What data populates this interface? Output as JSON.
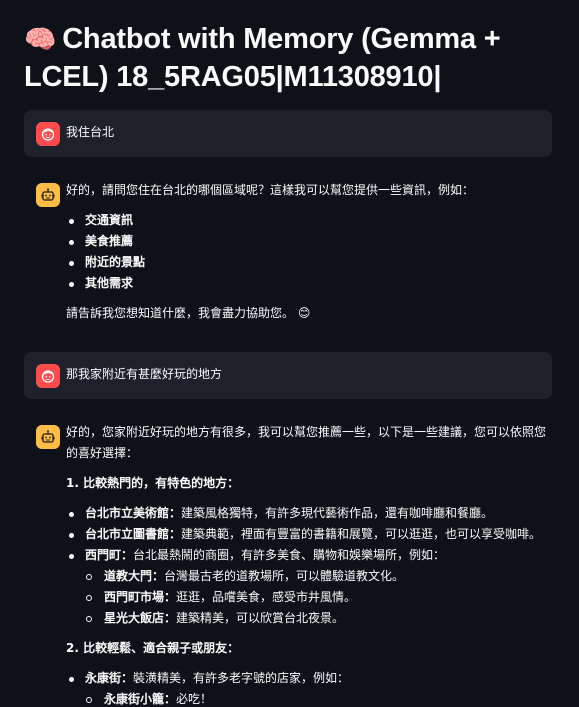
{
  "app": {
    "title": "Chatbot with Memory (Gemma + LCEL) 18_5RAG05|M11308910|",
    "title_icon": "🧠"
  },
  "colors": {
    "background": "#0e1117",
    "user_bubble": "#1e212b",
    "user_avatar": "#ff4b4b",
    "bot_avatar": "#ffbd45"
  },
  "messages": {
    "m1": {
      "role": "user",
      "avatar": "user-face-icon",
      "text": "我住台北"
    },
    "m2": {
      "role": "assistant",
      "avatar": "robot-icon",
      "intro": "好的，請問您住在台北的哪個區域呢？這樣我可以幫您提供一些資訊，例如：",
      "items": [
        "交通資訊",
        "美食推薦",
        "附近的景點",
        "其他需求"
      ],
      "outro": "請告訴我您想知道什麼，我會盡力協助您。",
      "emoji": "😊"
    },
    "m3": {
      "role": "user",
      "avatar": "user-face-icon",
      "text": "那我家附近有甚麼好玩的地方"
    },
    "m4": {
      "role": "assistant",
      "avatar": "robot-icon",
      "intro": "好的，您家附近好玩的地方有很多，我可以幫您推薦一些，以下是一些建議，您可以依照您的喜好選擇：",
      "section1": {
        "heading": "1. 比較熱門的，有特色的地方：",
        "items": [
          {
            "name": "台北市立美術館：",
            "desc": "建築風格獨特，有許多現代藝術作品，還有咖啡廳和餐廳。"
          },
          {
            "name": "台北市立圖書館：",
            "desc": "建築典範，裡面有豐富的書籍和展覽，可以逛逛，也可以享受咖啡。"
          },
          {
            "name": "西門町：",
            "desc": "台北最熱鬧的商圈，有許多美食、購物和娛樂場所，例如：",
            "sub": [
              {
                "name": "道教大門：",
                "desc": "台灣最古老的道教場所，可以體驗道教文化。"
              },
              {
                "name": "西門町市場：",
                "desc": "逛逛，品嚐美食，感受市井風情。"
              },
              {
                "name": "星光大飯店：",
                "desc": "建築精美，可以欣賞台北夜景。"
              }
            ]
          }
        ]
      },
      "section2": {
        "heading": "2. 比較輕鬆、適合親子或朋友：",
        "items": [
          {
            "name": "永康街：",
            "desc": "裝潢精美，有許多老字號的店家，例如：",
            "sub": [
              {
                "name": "永康街小籠：",
                "desc": "必吃！"
              }
            ]
          }
        ]
      }
    }
  }
}
